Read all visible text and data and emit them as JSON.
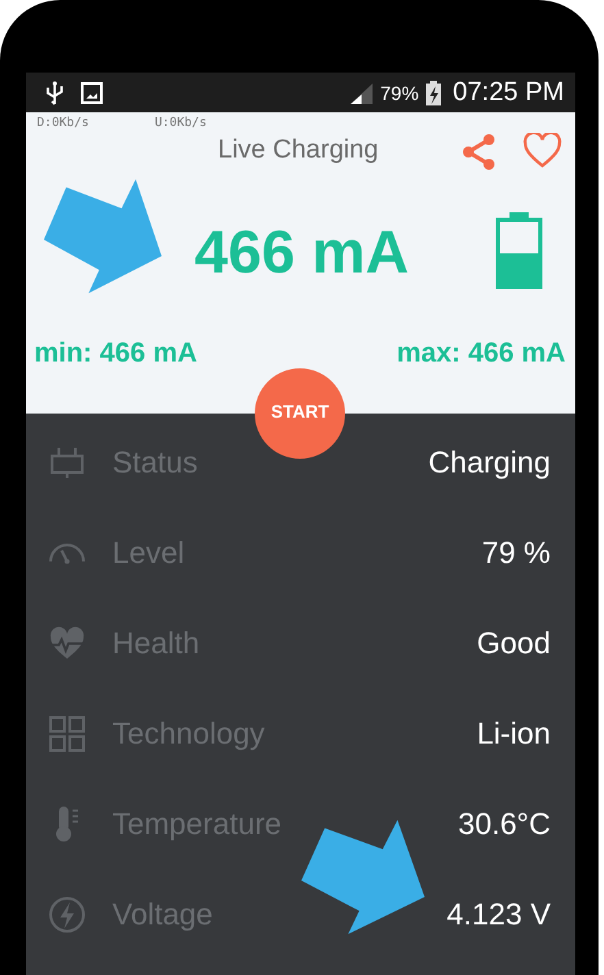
{
  "status_bar": {
    "battery": "79%",
    "time": "07:25 PM"
  },
  "header": {
    "download_speed": "D:0Kb/s",
    "upload_speed": "U:0Kb/s",
    "title": "Live Charging"
  },
  "current": {
    "reading": "466 mA",
    "min": "min: 466 mA",
    "max": "max: 466 mA",
    "level": 0.5
  },
  "start_button": "START",
  "stats": [
    {
      "kind": "plug",
      "label": "Status",
      "value": "Charging"
    },
    {
      "kind": "gauge",
      "label": "Level",
      "value": "79 %"
    },
    {
      "kind": "heart",
      "label": "Health",
      "value": "Good"
    },
    {
      "kind": "grid",
      "label": "Technology",
      "value": "Li-ion"
    },
    {
      "kind": "thermometer",
      "label": "Temperature",
      "value": "30.6°C"
    },
    {
      "kind": "bolt",
      "label": "Voltage",
      "value": "4.123 V"
    }
  ]
}
